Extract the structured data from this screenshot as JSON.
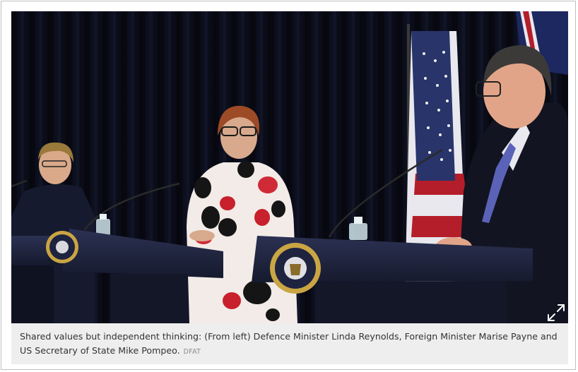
{
  "figure": {
    "caption_text": "Shared values but independent thinking: (From left) Defence Minister Linda Reynolds, Foreign Minister Marise Payne and US Secretary of State Mike Pompeo.",
    "credit": "DFAT",
    "expand_icon": "expand-icon",
    "colors": {
      "caption_bg": "#eeeeee",
      "caption_text": "#333333",
      "credit_text": "#8a8a8a",
      "photo_backdrop": "#0b0d18",
      "podium": "#222845"
    }
  }
}
